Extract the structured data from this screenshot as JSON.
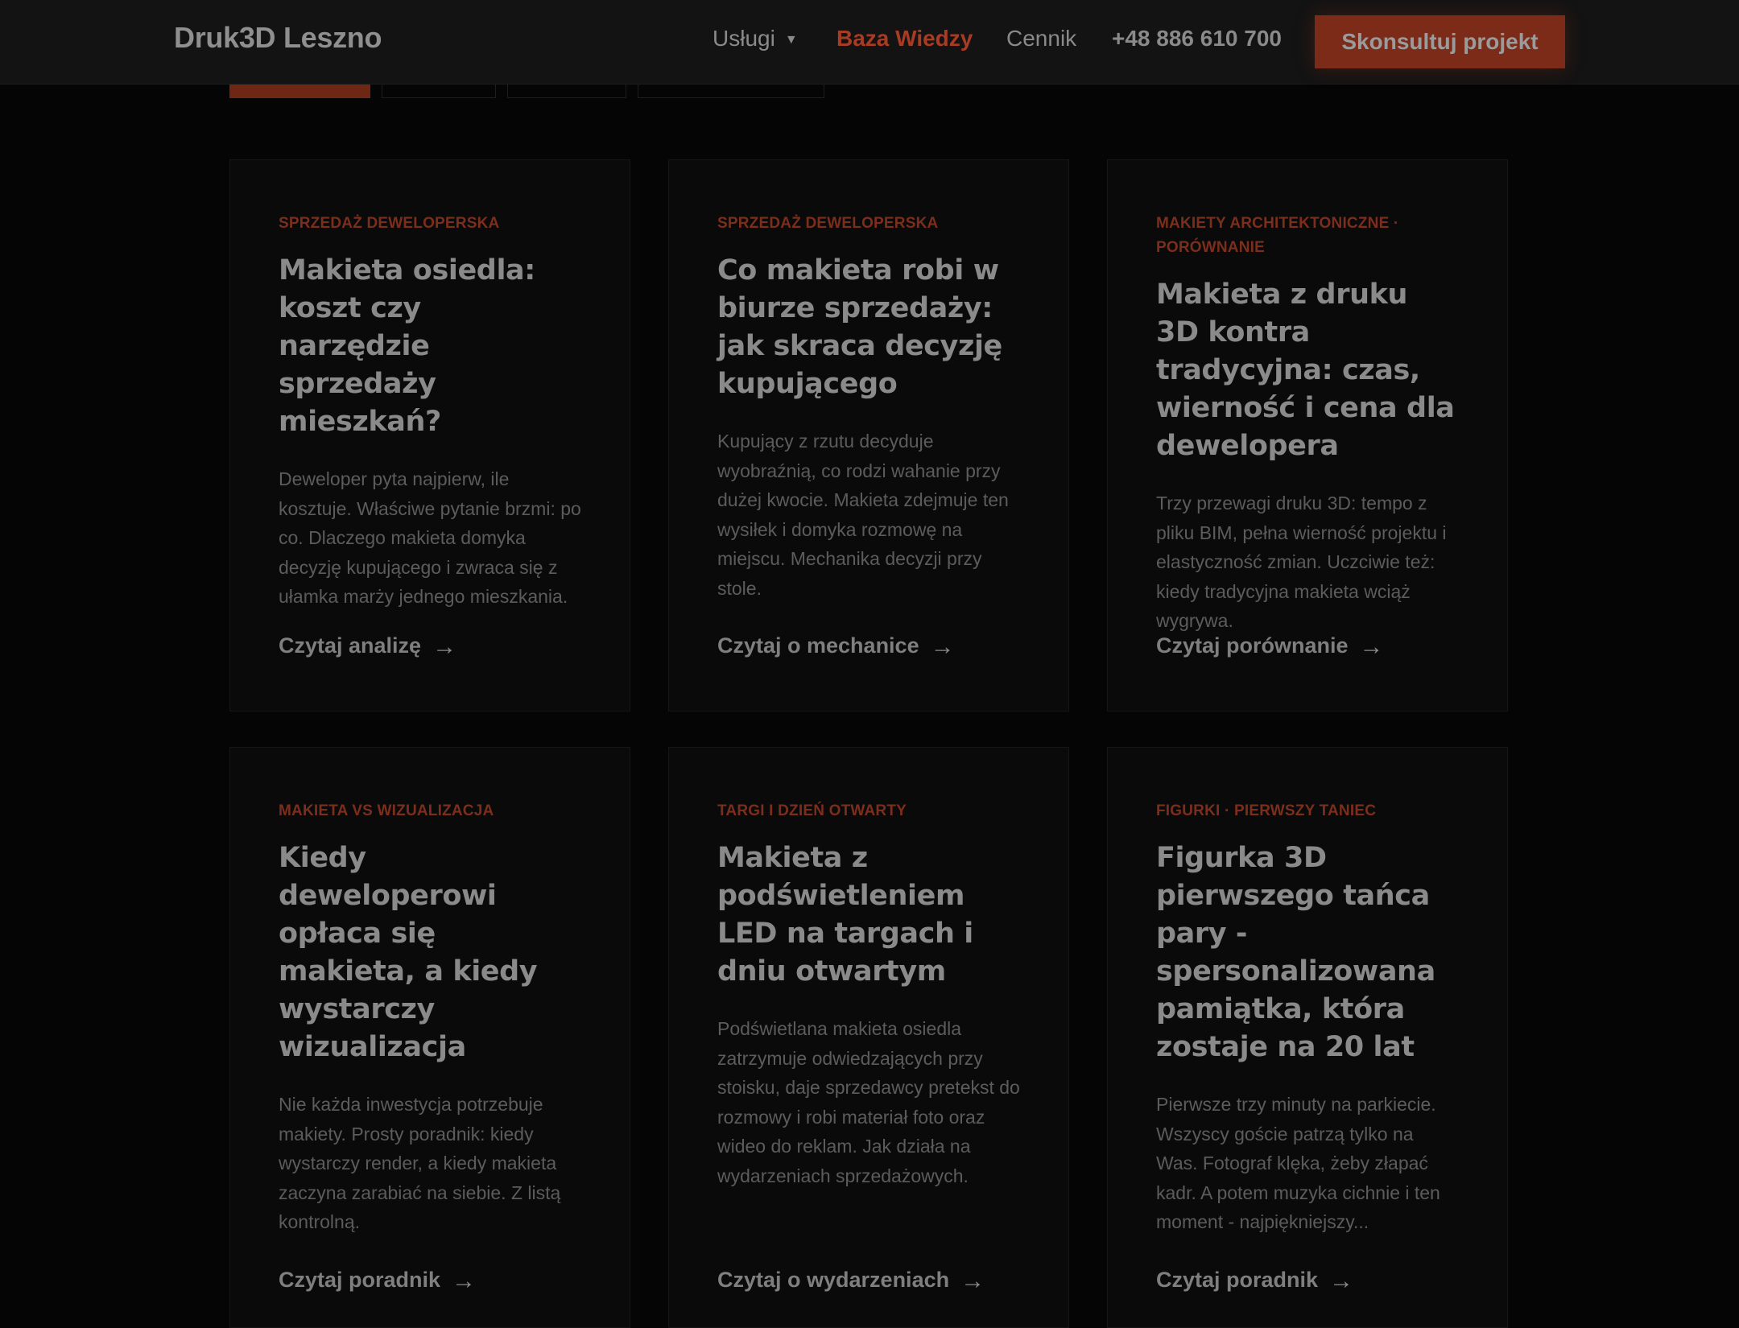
{
  "header": {
    "logo": "Druk3D Leszno",
    "nav": {
      "uslugi": "Usługi",
      "baza": "Baza Wiedzy",
      "cennik": "Cennik",
      "phone": "+48 886 610 700"
    },
    "cta": "Skonsultuj projekt"
  },
  "colors": {
    "accent": "#a83b23",
    "background": "#050505",
    "card": "#0a0a0a"
  },
  "cards": [
    {
      "category": "Sprzedaż deweloperska",
      "title": "Makieta osiedla: koszt czy narzędzie sprzedaży mieszkań?",
      "excerpt": "Deweloper pyta najpierw, ile kosztuje. Właściwe pytanie brzmi: po co. Dlaczego makieta domyka decyzję kupującego i zwraca się z ułamka marży jednego mieszkania.",
      "link": "Czytaj analizę"
    },
    {
      "category": "Sprzedaż deweloperska",
      "title": "Co makieta robi w biurze sprzedaży: jak skraca decyzję kupującego",
      "excerpt": "Kupujący z rzutu decyduje wyobraźnią, co rodzi wahanie przy dużej kwocie. Makieta zdejmuje ten wysiłek i domyka rozmowę na miejscu. Mechanika decyzji przy stole.",
      "link": "Czytaj o mechanice"
    },
    {
      "category": "Makiety architektoniczne · Porównanie",
      "title": "Makieta z druku 3D kontra tradycyjna: czas, wierność i cena dla dewelopera",
      "excerpt": "Trzy przewagi druku 3D: tempo z pliku BIM, pełna wierność projektu i elastyczność zmian. Uczciwie też: kiedy tradycyjna makieta wciąż wygrywa.",
      "link": "Czytaj porównanie"
    },
    {
      "category": "Makieta vs wizualizacja",
      "title": "Kiedy deweloperowi opłaca się makieta, a kiedy wystarczy wizualizacja",
      "excerpt": "Nie każda inwestycja potrzebuje makiety. Prosty poradnik: kiedy wystarczy render, a kiedy makieta zaczyna zarabiać na siebie. Z listą kontrolną.",
      "link": "Czytaj poradnik"
    },
    {
      "category": "Targi i dzień otwarty",
      "title": "Makieta z podświetleniem LED na targach i dniu otwartym",
      "excerpt": "Podświetlana makieta osiedla zatrzymuje odwiedzających przy stoisku, daje sprzedawcy pretekst do rozmowy i robi materiał foto oraz wideo do reklam. Jak działa na wydarzeniach sprzedażowych.",
      "link": "Czytaj o wydarzeniach"
    },
    {
      "category": "Figurki · Pierwszy taniec",
      "title": "Figurka 3D pierwszego tańca pary - spersonalizowana pamiątka, która zostaje na 20 lat",
      "excerpt": "Pierwsze trzy minuty na parkiecie. Wszyscy goście patrzą tylko na Was. Fotograf klęka, żeby złapać kadr. A potem muzyka cichnie i ten moment - najpiękniejszy...",
      "link": "Czytaj poradnik"
    }
  ]
}
